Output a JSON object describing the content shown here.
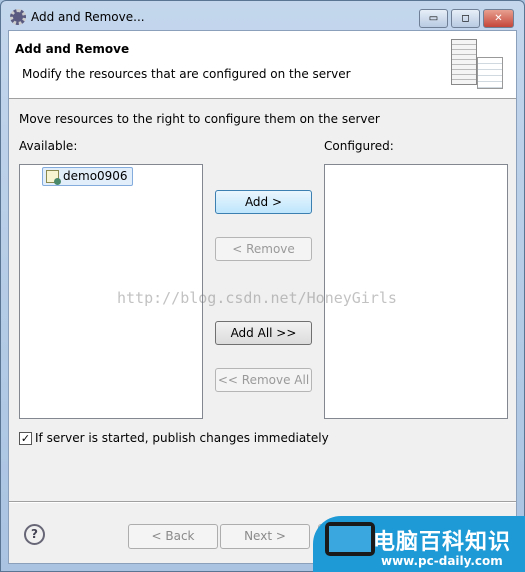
{
  "window": {
    "title": "Add and Remove...",
    "minimize": "▭",
    "maximize": "◻",
    "close": "✕"
  },
  "header": {
    "title": "Add and Remove",
    "description": "Modify the resources that are configured on the server"
  },
  "main": {
    "instruction": "Move resources to the right to configure them on the server",
    "available_label": "Available:",
    "configured_label": "Configured:",
    "available_items": [
      {
        "label": "demo0906"
      }
    ],
    "configured_items": [],
    "buttons": {
      "add": "Add >",
      "remove": "< Remove",
      "add_all": "Add All >>",
      "remove_all": "<< Remove All"
    },
    "publish_checkbox": {
      "label": "If server is started, publish changes immediately",
      "checked": true,
      "mark": "✓"
    }
  },
  "watermark_text": "http://blog.csdn.net/HoneyGirls",
  "footer": {
    "help": "?",
    "back": "< Back",
    "next": "Next >"
  },
  "logo_overlay": {
    "name": "电脑百科知识",
    "url": "www.pc-daily.com"
  }
}
